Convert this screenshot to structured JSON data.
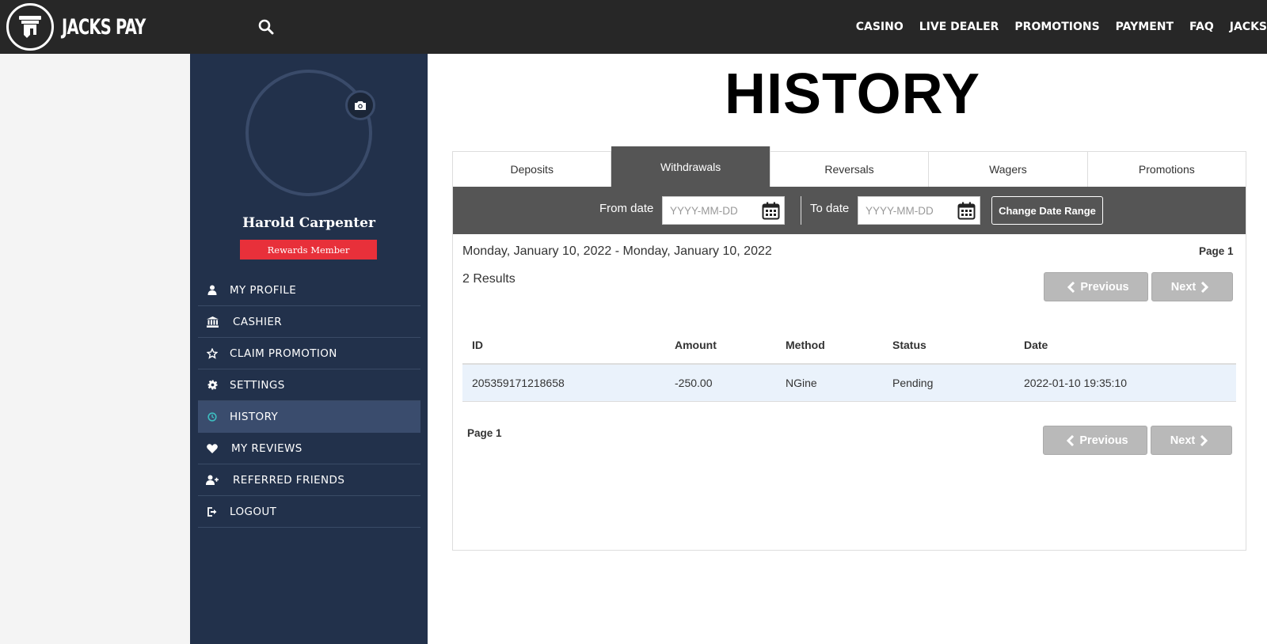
{
  "header": {
    "logo_text": "JACKS PAY",
    "nav": [
      "CASINO",
      "LIVE DEALER",
      "PROMOTIONS",
      "PAYMENT",
      "FAQ",
      "JACKS"
    ]
  },
  "sidebar": {
    "user_name": "Harold Carpenter",
    "badge": "Rewards Member",
    "items": [
      {
        "label": "MY PROFILE",
        "icon": "user-icon"
      },
      {
        "label": "CASHIER",
        "icon": "bank-icon"
      },
      {
        "label": "CLAIM PROMOTION",
        "icon": "star-icon"
      },
      {
        "label": "SETTINGS",
        "icon": "gear-icon"
      },
      {
        "label": "HISTORY",
        "icon": "clock-icon",
        "active": true
      },
      {
        "label": "MY REVIEWS",
        "icon": "heart-icon"
      },
      {
        "label": "REFERRED FRIENDS",
        "icon": "user-plus-icon"
      },
      {
        "label": "LOGOUT",
        "icon": "logout-icon"
      }
    ]
  },
  "main": {
    "title": "HISTORY",
    "tabs": [
      "Deposits",
      "Withdrawals",
      "Reversals",
      "Wagers",
      "Promotions"
    ],
    "active_tab": "Withdrawals",
    "filter": {
      "from_label": "From date",
      "from_placeholder": "YYYY-MM-DD",
      "to_label": "To date",
      "to_placeholder": "YYYY-MM-DD",
      "change_button": "Change Date Range"
    },
    "range_text": "Monday, January 10, 2022 - Monday, January 10, 2022",
    "results_text": "2 Results",
    "page_label": "Page 1",
    "prev_label": "Previous",
    "next_label": "Next",
    "table": {
      "columns": [
        "ID",
        "Amount",
        "Method",
        "Status",
        "Date"
      ],
      "rows": [
        [
          "205359171218658",
          "-250.00",
          "NGine",
          "Pending",
          "2022-01-10 19:35:10"
        ]
      ]
    }
  },
  "colors": {
    "header_bg": "#272727",
    "sidebar_bg": "#22314b",
    "sidebar_active": "#3a4c6d",
    "badge_red": "#e8303a",
    "filter_bar": "#555555",
    "active_icon": "#3dbdc0"
  }
}
